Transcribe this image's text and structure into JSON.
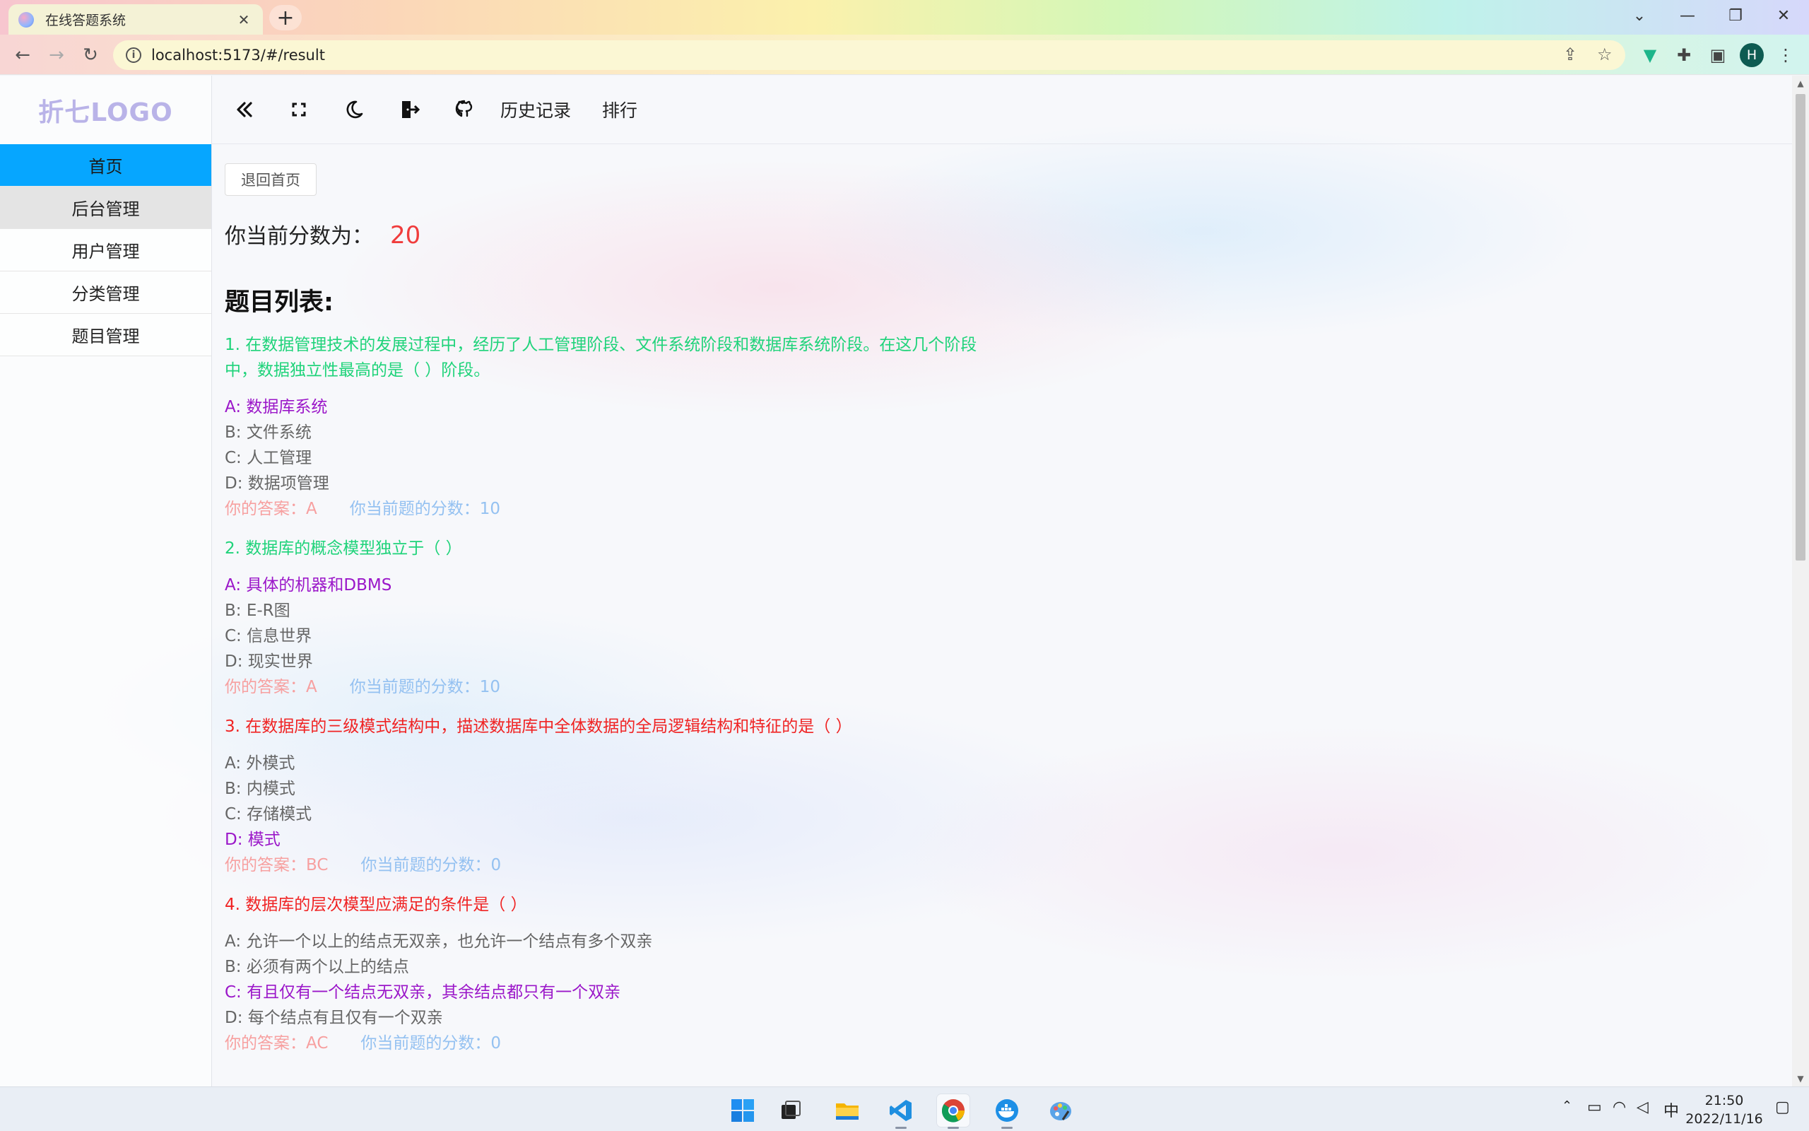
{
  "browser": {
    "tab_title": "在线答题系统",
    "tab_close": "✕",
    "new_tab": "+",
    "url": "localhost:5173/#/result",
    "avatar_letter": "H"
  },
  "sidebar": {
    "logo": "折七LOGO",
    "items": [
      {
        "label": "首页"
      },
      {
        "label": "后台管理"
      },
      {
        "label": "用户管理"
      },
      {
        "label": "分类管理"
      },
      {
        "label": "题目管理"
      }
    ]
  },
  "topnav": {
    "icons": [
      "collapse-icon",
      "fullscreen-icon",
      "dark-mode-icon",
      "logout-icon",
      "github-icon"
    ],
    "links": [
      {
        "label": "历史记录"
      },
      {
        "label": "排行"
      }
    ]
  },
  "content": {
    "back_button": "退回首页",
    "score_label": "你当前分数为：",
    "score_value": "20",
    "list_title": "题目列表:",
    "questions": [
      {
        "title": "1. 在数据管理技术的发展过程中，经历了人工管理阶段、文件系统阶段和数据库系统阶段。在这几个阶段中，数据独立性最高的是（ ）阶段。",
        "status": "ok",
        "options": [
          {
            "text": "A: 数据库系统",
            "correct": true
          },
          {
            "text": "B: 文件系统",
            "correct": false
          },
          {
            "text": "C: 人工管理",
            "correct": false
          },
          {
            "text": "D: 数据项管理",
            "correct": false
          }
        ],
        "my_answer": "你的答案：A",
        "points": "你当前题的分数：10"
      },
      {
        "title": "2. 数据库的概念模型独立于（ ）",
        "status": "ok",
        "options": [
          {
            "text": "A: 具体的机器和DBMS",
            "correct": true
          },
          {
            "text": "B: E-R图",
            "correct": false
          },
          {
            "text": "C: 信息世界",
            "correct": false
          },
          {
            "text": "D: 现实世界",
            "correct": false
          }
        ],
        "my_answer": "你的答案：A",
        "points": "你当前题的分数：10"
      },
      {
        "title": "3. 在数据库的三级模式结构中，描述数据库中全体数据的全局逻辑结构和特征的是（ ）",
        "status": "bad",
        "options": [
          {
            "text": "A: 外模式",
            "correct": false
          },
          {
            "text": "B: 内模式",
            "correct": false
          },
          {
            "text": "C: 存储模式",
            "correct": false
          },
          {
            "text": "D: 模式",
            "correct": true
          }
        ],
        "my_answer": "你的答案：BC",
        "points": "你当前题的分数：0"
      },
      {
        "title": "4. 数据库的层次模型应满足的条件是（ ）",
        "status": "bad",
        "options": [
          {
            "text": "A: 允许一个以上的结点无双亲，也允许一个结点有多个双亲",
            "correct": false
          },
          {
            "text": "B: 必须有两个以上的结点",
            "correct": false
          },
          {
            "text": "C: 有且仅有一个结点无双亲，其余结点都只有一个双亲",
            "correct": true
          },
          {
            "text": "D: 每个结点有且仅有一个双亲",
            "correct": false
          }
        ],
        "my_answer": "你的答案：AC",
        "points": "你当前题的分数：0"
      }
    ]
  },
  "taskbar": {
    "ime": "中",
    "time": "21:50",
    "date": "2022/11/16"
  },
  "colors": {
    "active_menu": "#06a6ff",
    "correct_title": "#1fd37a",
    "wrong_title": "#f02323",
    "correct_option": "#9b17c9",
    "score": "#f03c3c"
  }
}
